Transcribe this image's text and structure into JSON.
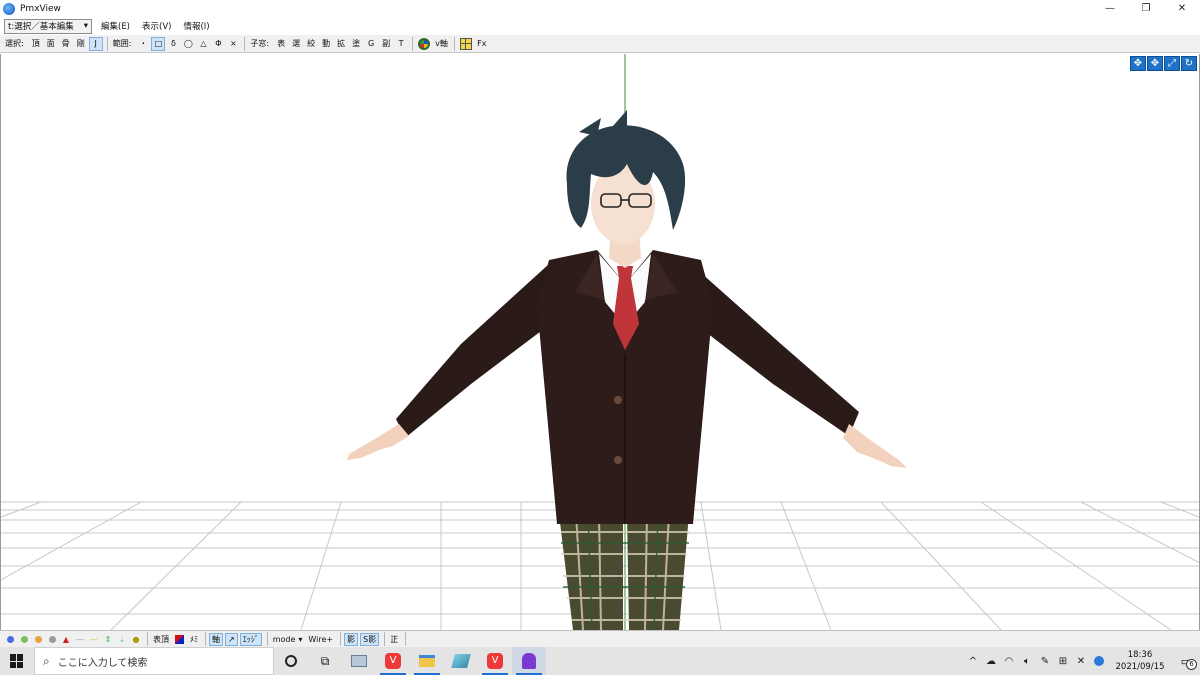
{
  "window": {
    "title": "PmxView",
    "minimize_glyph": "—",
    "restore_glyph": "❐",
    "close_glyph": "✕"
  },
  "menubar": {
    "mode_select": "t:選択／基本編集",
    "items": [
      "編集(E)",
      "表示(V)",
      "情報(I)"
    ]
  },
  "toolbar": {
    "select_label": "選択:",
    "select_buttons": [
      "頂",
      "面",
      "骨",
      "剛",
      "J"
    ],
    "range_label": "範囲:",
    "range_buttons": [
      "・",
      "□",
      "δ",
      "◯",
      "△",
      "Φ",
      "×"
    ],
    "child_label": "子窓:",
    "child_buttons": [
      "表",
      "選",
      "絞",
      "動",
      "拡",
      "塗",
      "G",
      "副",
      "T"
    ],
    "vaxis_label": "v軸",
    "fx_label": "Fx"
  },
  "viewport": {
    "nav_icons": [
      "move-xy-icon",
      "move-xz-icon",
      "zoom-icon",
      "rotate-icon"
    ],
    "background": "#ffffff",
    "grid_color": "#c8c8c8",
    "axis_color": "#3c8c3c"
  },
  "statusbar": {
    "item_labels": [
      "表頂",
      "ﾒﾐ",
      "軸",
      "ｴｯｼﾞ",
      "mode",
      "Wire+",
      "影",
      "S影",
      "正"
    ]
  },
  "taskbar": {
    "search_placeholder": "ここに入力して検索",
    "time": "18:36",
    "date": "2021/09/15",
    "notification_count": "6"
  },
  "colors": {
    "accent": "#1e73c9",
    "active_tool_bg": "#cde3f7"
  }
}
